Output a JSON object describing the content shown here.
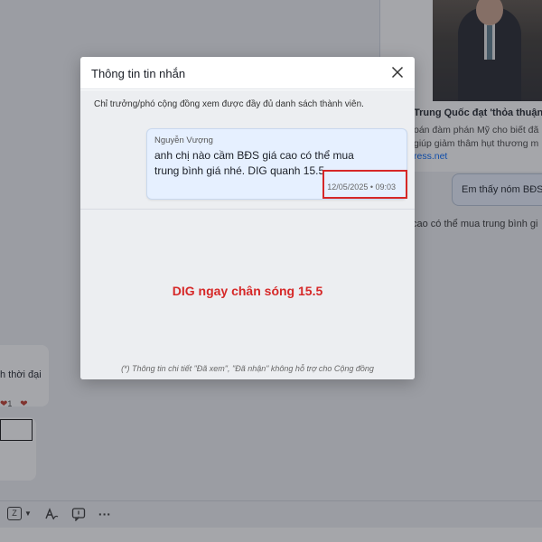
{
  "background": {
    "news": {
      "title": "Trung Quốc đạt 'thỏa thuận đá",
      "desc_line1": "oán đàm phán Mỹ cho biết đã",
      "desc_line2": "giúp giảm thâm hụt thương m",
      "source": "ress.net"
    },
    "reply_bubble": "Em thấy nóm BĐS",
    "quoted_line": "cao có thể mua trung bình gi",
    "left_message": "h thời đại",
    "reaction_count": "1",
    "toolbar": {
      "format_badge": "Z",
      "more": "···"
    }
  },
  "modal": {
    "title": "Thông tin tin nhắn",
    "notice": "Chỉ trưởng/phó cộng đồng xem được đầy đủ danh sách thành viên.",
    "message": {
      "sender": "Nguyễn Vượng",
      "text": "anh chị nào cầm BĐS giá cao có thể mua trung bình giá nhé. DIG quanh 15.5",
      "timestamp": "12/05/2025 • 09:03"
    },
    "caption": "DIG ngay chân sóng 15.5",
    "footnote": "(*) Thông tin chi tiết \"Đã xem\", \"Đã nhận\" không hỗ trợ cho Cộng đồng"
  },
  "colors": {
    "highlight": "#d62828",
    "bubble": "#e6f0ff",
    "overlay": "rgba(40,44,52,0.42)"
  },
  "icons": [
    "close-icon",
    "heart-icon",
    "format-icon",
    "text-style-icon",
    "quick-reply-icon",
    "more-icon"
  ]
}
